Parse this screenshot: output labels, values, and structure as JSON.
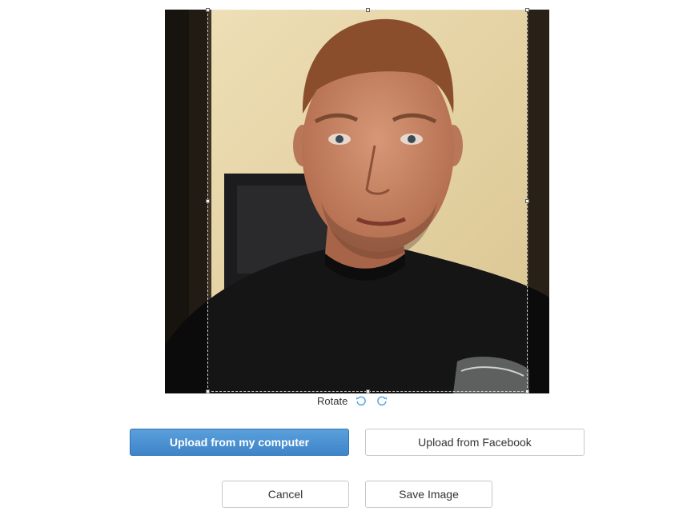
{
  "editor": {
    "image_alt": "Profile photo",
    "rotate_label": "Rotate",
    "rotate_left_icon": "rotate-left-icon",
    "rotate_right_icon": "rotate-right-icon"
  },
  "actions": {
    "upload_computer_label": "Upload from my computer",
    "upload_facebook_label": "Upload from Facebook",
    "cancel_label": "Cancel",
    "save_label": "Save Image"
  },
  "colors": {
    "primary": "#4a90d2",
    "icon_blue": "#5aaae0"
  }
}
